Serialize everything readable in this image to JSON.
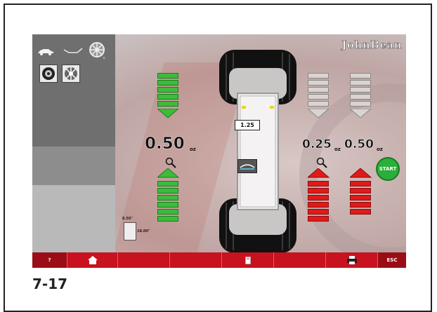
{
  "brand": "JohnBean",
  "caption": "7-17",
  "sidebar": {
    "top_icons": [
      "car-icon",
      "rim-profile-icon",
      "alloy-wheel-icon"
    ],
    "mode_buttons": [
      "static-weight-icon",
      "alloy-mode-icon"
    ],
    "dimensions": {
      "width_label": "8.50\"",
      "diameter_label": "18.00\""
    }
  },
  "center": {
    "runout_value": "1.25"
  },
  "left_plane": {
    "value": "0.50",
    "unit": "oz",
    "upper_bar": {
      "color": "green",
      "filled": 5,
      "total": 5
    },
    "lower_bar": {
      "color": "green",
      "filled": 6,
      "total": 6
    }
  },
  "right_plane_inner": {
    "value": "0.25",
    "unit": "oz",
    "upper_bar": {
      "color": "empty",
      "filled": 0,
      "total": 5
    },
    "lower_bar": {
      "color": "red",
      "filled": 6,
      "total": 6
    }
  },
  "right_plane_outer": {
    "value": "0.50",
    "unit": "oz",
    "upper_bar": {
      "color": "empty",
      "filled": 0,
      "total": 5
    },
    "lower_bar": {
      "color": "red",
      "filled": 5,
      "total": 5
    }
  },
  "start_button": "START",
  "bottom_bar": {
    "help": "?",
    "home_icon": "home-icon",
    "bin_icon": "weight-bin-icon",
    "print_icon": "printer-icon",
    "esc": "ESC"
  },
  "colors": {
    "bar_green": "#3cbb3c",
    "bar_red": "#e01a1a",
    "bottom_bar": "#c8121f",
    "start": "#2cae3a"
  }
}
